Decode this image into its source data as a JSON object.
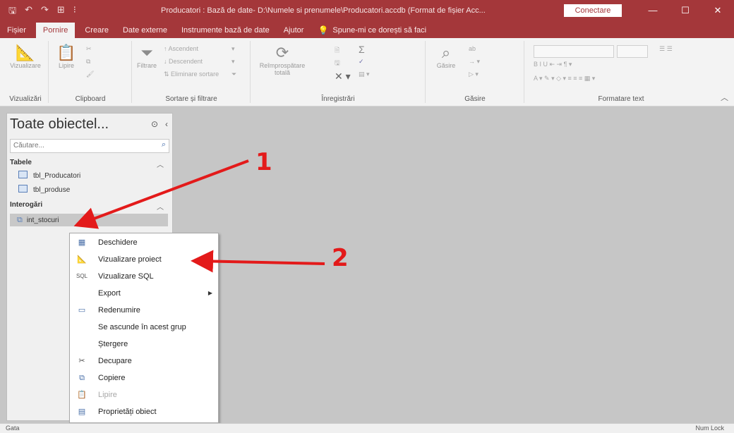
{
  "window": {
    "title": "Producatori : Bază de date- D:\\Numele si prenumele\\Producatori.accdb (Format de fișier Acc...",
    "connect_label": "Conectare",
    "minimize": "—",
    "restore": "☐",
    "close": "✕"
  },
  "tabs": [
    "Fișier",
    "Pornire",
    "Creare",
    "Date externe",
    "Instrumente bază de date",
    "Ajutor"
  ],
  "tell_me": "Spune-mi ce dorești să faci",
  "ribbon": {
    "groups": {
      "views": "Vizualizări",
      "clipboard": "Clipboard",
      "sort_filter": "Sortare și filtrare",
      "records": "Înregistrări",
      "find": "Găsire",
      "text_format": "Formatare text"
    },
    "buttons": {
      "view": "Vizualizare",
      "paste": "Lipire",
      "filter": "Filtrare",
      "ascending": "Ascendent",
      "descending": "Descendent",
      "remove_sort": "Eliminare sortare",
      "refresh": "Reîmprospătare totală",
      "find": "Găsire"
    }
  },
  "nav": {
    "header": "Toate obiectel...",
    "search_placeholder": "Căutare...",
    "sections": {
      "tables": "Tabele",
      "queries": "Interogări"
    },
    "tables": [
      "tbl_Producatori",
      "tbl_produse"
    ],
    "queries": [
      "int_stocuri"
    ]
  },
  "context_menu": {
    "items": [
      {
        "label": "Deschidere",
        "icon": "open-icon",
        "disabled": false
      },
      {
        "label": "Vizualizare proiect",
        "icon": "design-view-icon",
        "disabled": false
      },
      {
        "label": "Vizualizare SQL",
        "icon": "sql-icon",
        "disabled": false
      },
      {
        "label": "Export",
        "icon": "",
        "disabled": false,
        "submenu": true
      },
      {
        "label": "Redenumire",
        "icon": "rename-icon",
        "disabled": false
      },
      {
        "label": "Se ascunde în acest grup",
        "icon": "",
        "disabled": false
      },
      {
        "label": "Ștergere",
        "icon": "",
        "disabled": false
      },
      {
        "label": "Decupare",
        "icon": "cut-icon",
        "disabled": false
      },
      {
        "label": "Copiere",
        "icon": "copy-icon",
        "disabled": false
      },
      {
        "label": "Lipire",
        "icon": "paste-icon",
        "disabled": true
      },
      {
        "label": "Proprietăți obiect",
        "icon": "properties-icon",
        "disabled": false
      }
    ]
  },
  "status": {
    "left": "Gata",
    "right": "Num Lock"
  },
  "annotations": {
    "label_1": "1",
    "label_2": "2",
    "color": "#e31a1a"
  },
  "colors": {
    "accent": "#a4373a",
    "ribbon_bg": "#f3f3f3",
    "workspace": "#c6c6c6"
  }
}
